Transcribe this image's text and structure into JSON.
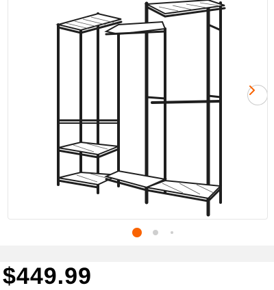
{
  "gallery": {
    "image_alt": "",
    "next_label": "",
    "slide_count": 3,
    "active_slide": 0,
    "accent_color": "#f96302",
    "rack_color": "#1f1f1f"
  },
  "price": {
    "text": "$449.99"
  }
}
